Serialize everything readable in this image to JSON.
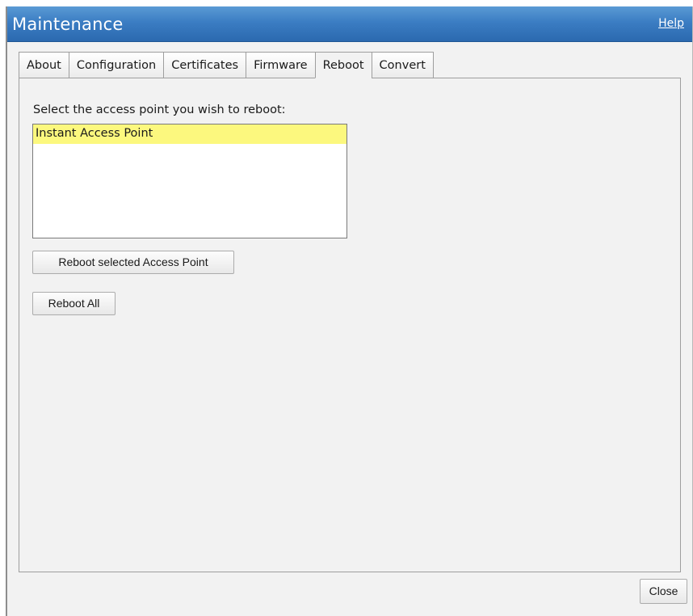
{
  "window": {
    "title": "Maintenance",
    "help_label": "Help"
  },
  "tabs": [
    {
      "label": "About",
      "active": false
    },
    {
      "label": "Configuration",
      "active": false
    },
    {
      "label": "Certificates",
      "active": false
    },
    {
      "label": "Firmware",
      "active": false
    },
    {
      "label": "Reboot",
      "active": true
    },
    {
      "label": "Convert",
      "active": false
    }
  ],
  "reboot": {
    "prompt": "Select the access point you wish to reboot:",
    "access_points": [
      {
        "name": "Instant Access Point",
        "selected": true
      }
    ],
    "reboot_selected_label": "Reboot selected Access Point",
    "reboot_all_label": "Reboot All"
  },
  "footer": {
    "close_label": "Close"
  },
  "colors": {
    "titlebar": "#3b7dc3",
    "selection_highlight": "#fcf87e",
    "panel_background": "#f2f2f2"
  }
}
